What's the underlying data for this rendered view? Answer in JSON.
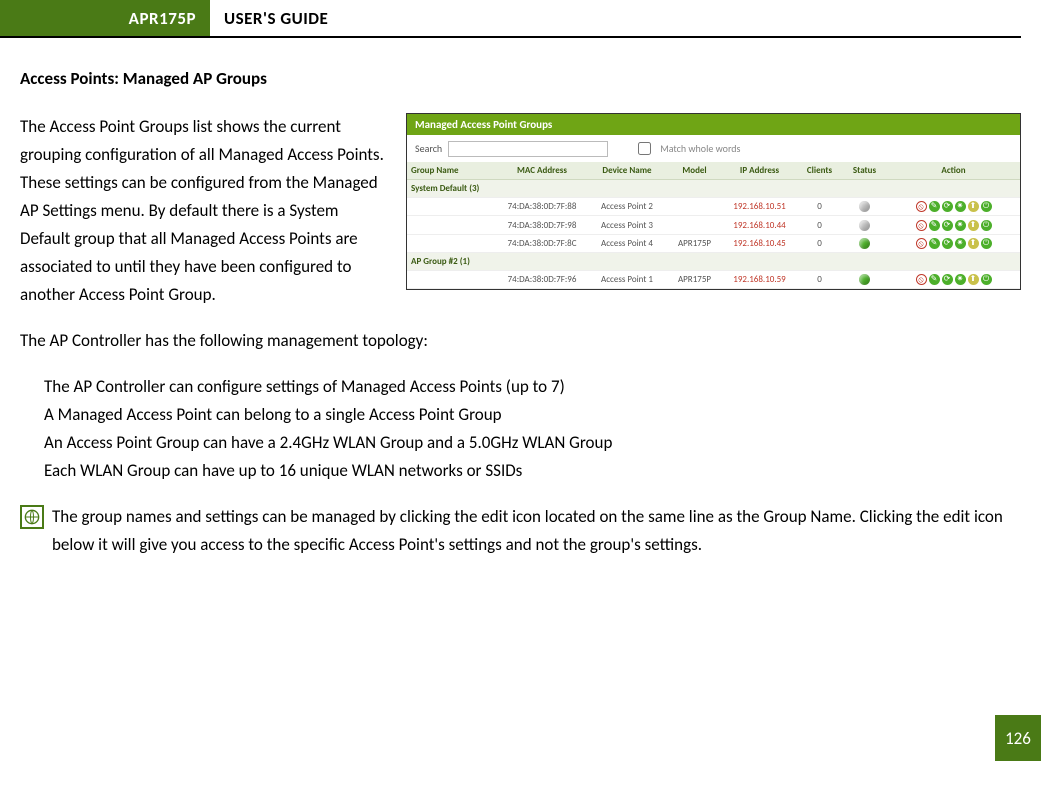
{
  "header": {
    "model": "APR175P",
    "title": "USER'S GUIDE"
  },
  "section_title": "Access Points: Managed AP Groups",
  "intro_para": "The Access Point Groups list shows the current grouping configuration of all Managed Access Points. These settings can be configured from the Managed AP Settings menu.  By default there is a System Default group that all Managed Access Points are associated to until they have been configured to another Access Point Group.",
  "topology_intro": "The AP Controller has the following management topology:",
  "topology": [
    "The AP Controller can configure settings of Managed Access Points (up to 7)",
    "A Managed Access Point can belong to a single Access Point Group",
    "An Access Point Group can have a 2.4GHz WLAN Group and a 5.0GHz WLAN Group",
    "Each WLAN Group can have up to 16 unique WLAN networks or SSIDs"
  ],
  "note": "The group names and settings can be managed by clicking the edit icon located on the same line as the Group Name.  Clicking the edit icon below it will give you access to the specific Access Point's settings and not the group's settings.",
  "page_number": "126",
  "figure": {
    "panel_title": "Managed Access Point Groups",
    "search_label": "Search",
    "search_placeholder": "",
    "checkbox_label": "Match whole words",
    "columns": [
      "Group Name",
      "MAC Address",
      "Device Name",
      "Model",
      "IP Address",
      "Clients",
      "Status",
      "Action"
    ],
    "groups": [
      {
        "name": "System Default (3)",
        "rows": [
          {
            "mac": "74:DA:38:0D:7F:88",
            "device": "Access Point 2",
            "model": "",
            "ip": "192.168.10.51",
            "clients": "0",
            "status": "grey"
          },
          {
            "mac": "74:DA:38:0D:7F:98",
            "device": "Access Point 3",
            "model": "",
            "ip": "192.168.10.44",
            "clients": "0",
            "status": "grey"
          },
          {
            "mac": "74:DA:38:0D:7F:8C",
            "device": "Access Point 4",
            "model": "APR175P",
            "ip": "192.168.10.45",
            "clients": "0",
            "status": "green"
          }
        ]
      },
      {
        "name": "AP Group #2 (1)",
        "rows": [
          {
            "mac": "74:DA:38:0D:7F:96",
            "device": "Access Point 1",
            "model": "APR175P",
            "ip": "192.168.10.59",
            "clients": "0",
            "status": "green"
          }
        ]
      }
    ]
  }
}
